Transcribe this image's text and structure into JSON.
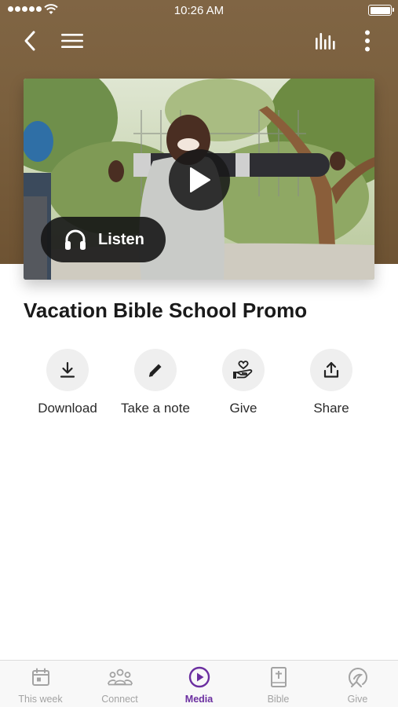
{
  "status_bar": {
    "time": "10:26 AM"
  },
  "nav": {
    "back_icon": "chevron-left-icon",
    "menu_icon": "hamburger-menu-icon",
    "equalizer_icon": "audio-bars-icon",
    "more_icon": "vertical-dots-icon"
  },
  "media": {
    "title": "Vacation Bible School Promo",
    "listen_label": "Listen",
    "play_icon": "play-icon",
    "listen_icon": "headphones-icon"
  },
  "actions": [
    {
      "label": "Download",
      "icon": "download-icon"
    },
    {
      "label": "Take a note",
      "icon": "pencil-icon"
    },
    {
      "label": "Give",
      "icon": "heart-hand-icon"
    },
    {
      "label": "Share",
      "icon": "share-icon"
    }
  ],
  "tabs": [
    {
      "label": "This week",
      "icon": "calendar-icon",
      "active": false
    },
    {
      "label": "Connect",
      "icon": "people-icon",
      "active": false
    },
    {
      "label": "Media",
      "icon": "play-circle-icon",
      "active": true
    },
    {
      "label": "Bible",
      "icon": "bible-icon",
      "active": false
    },
    {
      "label": "Give",
      "icon": "give-icon",
      "active": false
    }
  ],
  "colors": {
    "header_brown": "#7a5f3d",
    "accent_purple": "#6b2fa0",
    "inactive_tab": "#a3a3a3"
  }
}
